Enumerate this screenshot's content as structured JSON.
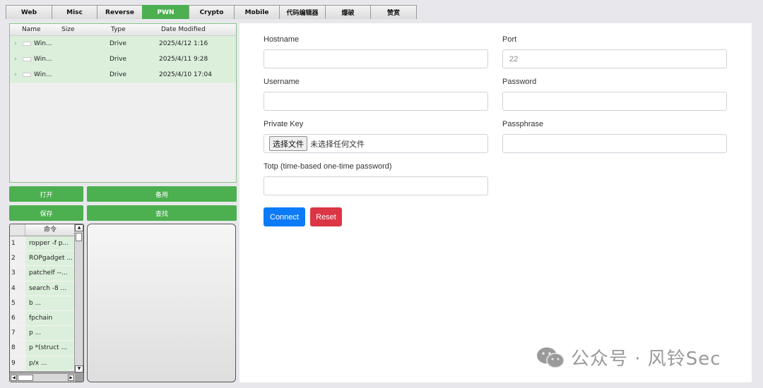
{
  "tabs": [
    {
      "label": "Web",
      "active": false
    },
    {
      "label": "Misc",
      "active": false
    },
    {
      "label": "Reverse",
      "active": false
    },
    {
      "label": "PWN",
      "active": true
    },
    {
      "label": "Crypto",
      "active": false
    },
    {
      "label": "Mobile",
      "active": false
    },
    {
      "label": "代码编辑器",
      "active": false
    },
    {
      "label": "爆破",
      "active": false
    },
    {
      "label": "赞赏",
      "active": false
    }
  ],
  "file_tree": {
    "columns": [
      "Name",
      "Size",
      "Type",
      "Date Modified"
    ],
    "rows": [
      {
        "name": "Win...",
        "size": "",
        "type": "Drive",
        "date": "2025/4/12 1:16"
      },
      {
        "name": "Win...",
        "size": "",
        "type": "Drive",
        "date": "2025/4/11 9:28"
      },
      {
        "name": "Win...",
        "size": "",
        "type": "Drive",
        "date": "2025/4/10 17:04"
      }
    ]
  },
  "buttons": {
    "open": "打开",
    "backup": "备用",
    "save": "保存",
    "find": "查找"
  },
  "commands": {
    "header": "命令",
    "items": [
      {
        "num": "1",
        "text": "ropper -f p..."
      },
      {
        "num": "2",
        "text": "ROPgadget ..."
      },
      {
        "num": "3",
        "text": "patchelf --..."
      },
      {
        "num": "4",
        "text": "search -8 ..."
      },
      {
        "num": "5",
        "text": "b ..."
      },
      {
        "num": "6",
        "text": "fpchain"
      },
      {
        "num": "7",
        "text": "p ..."
      },
      {
        "num": "8",
        "text": "p *(struct ..."
      },
      {
        "num": "9",
        "text": "p/x ..."
      }
    ]
  },
  "form": {
    "hostname_label": "Hostname",
    "hostname_value": "",
    "port_label": "Port",
    "port_placeholder": "22",
    "username_label": "Username",
    "username_value": "",
    "password_label": "Password",
    "password_value": "",
    "private_key_label": "Private Key",
    "choose_file_label": "选择文件",
    "no_file_text": "未选择任何文件",
    "passphrase_label": "Passphrase",
    "passphrase_value": "",
    "totp_label": "Totp (time-based one-time password)",
    "totp_value": "",
    "connect_label": "Connect",
    "reset_label": "Reset"
  },
  "watermark": {
    "text": "公众号 · 风铃Sec",
    "icon": "wechat-icon"
  },
  "colors": {
    "accent_green": "#4caf50",
    "row_green": "#dbefdb",
    "connect_blue": "#0d7bf8",
    "reset_red": "#dc3545",
    "watermark_gray": "#9a9a9a"
  }
}
